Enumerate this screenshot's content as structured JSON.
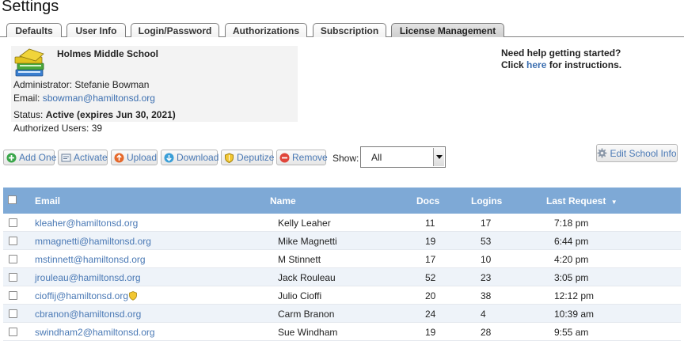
{
  "page": {
    "title": "Settings"
  },
  "tabs": [
    {
      "label": "Defaults"
    },
    {
      "label": "User Info"
    },
    {
      "label": "Login/Password"
    },
    {
      "label": "Authorizations"
    },
    {
      "label": "Subscription"
    },
    {
      "label": "License Management",
      "active": true
    }
  ],
  "school": {
    "name": "Holmes Middle School",
    "admin_label": "Administrator:",
    "admin_name": "Stefanie Bowman",
    "email_label": "Email:",
    "email": "sbowman@hamiltonsd.org",
    "status_label": "Status:",
    "status": "Active (expires Jun 30, 2021)",
    "authorized_label": "Authorized Users:",
    "authorized_count": "39"
  },
  "help": {
    "line1": "Need help getting started?",
    "click": "Click",
    "link": "here",
    "suffix": "for instructions."
  },
  "toolbar": {
    "add_one": "Add One",
    "activate": "Activate",
    "upload": "Upload",
    "download": "Download",
    "deputize": "Deputize",
    "remove": "Remove",
    "show_label": "Show:",
    "show_value": "All",
    "edit_school": "Edit School Info"
  },
  "table": {
    "columns": {
      "email": "Email",
      "name": "Name",
      "docs": "Docs",
      "logins": "Logins",
      "last_request": "Last Request"
    },
    "sort_indicator": "▼",
    "rows": [
      {
        "email": "kleaher@hamiltonsd.org",
        "name": "Kelly Leaher",
        "docs": "11",
        "logins": "17",
        "last": "7:18 pm"
      },
      {
        "email": "mmagnetti@hamiltonsd.org",
        "name": "Mike Magnetti",
        "docs": "19",
        "logins": "53",
        "last": "6:44 pm"
      },
      {
        "email": "mstinnett@hamiltonsd.org",
        "name": "M Stinnett",
        "docs": "17",
        "logins": "10",
        "last": "4:20 pm"
      },
      {
        "email": "jrouleau@hamiltonsd.org",
        "name": "Jack Rouleau",
        "docs": "52",
        "logins": "23",
        "last": "3:05 pm"
      },
      {
        "email": "cioffij@hamiltonsd.org",
        "name": "Julio Cioffi",
        "docs": "20",
        "logins": "38",
        "last": "12:12 pm",
        "deputy": true
      },
      {
        "email": "cbranon@hamiltonsd.org",
        "name": "Carm Branon",
        "docs": "24",
        "logins": "4",
        "last": "10:39 am"
      },
      {
        "email": "swindham2@hamiltonsd.org",
        "name": "Sue Windham",
        "docs": "19",
        "logins": "28",
        "last": "9:55 am"
      }
    ]
  },
  "colors": {
    "header_bg": "#7ea9d6",
    "link": "#3c6fb0",
    "row_alt": "#eef3f9"
  }
}
